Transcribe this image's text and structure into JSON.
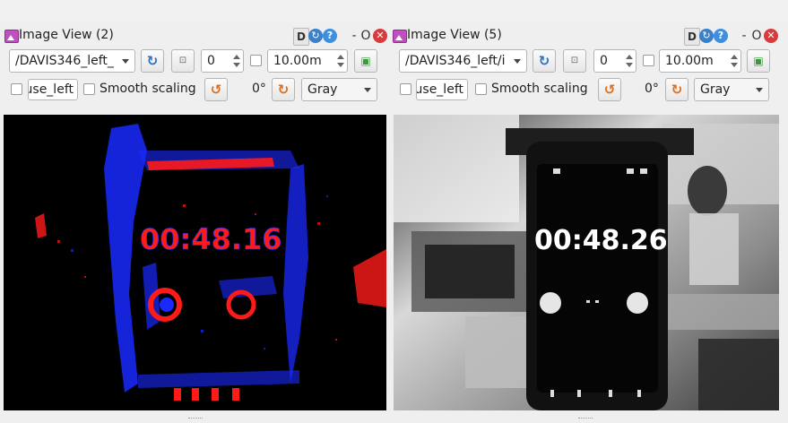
{
  "panels": [
    {
      "title": "Image View (2)",
      "titlebar_buttons": {
        "d": "D",
        "dash": "-",
        "o": "O",
        "help": "?",
        "close": "✕"
      },
      "topic": "/DAVIS346_left_",
      "spin_value": "0",
      "distance": "10.00m",
      "mouse_topic": "use_left",
      "smooth_label": "Smooth scaling",
      "rotation": "0°",
      "colormap": "Gray",
      "overlay": {
        "clock": "00:48.16"
      }
    },
    {
      "title": "Image View (5)",
      "titlebar_buttons": {
        "d": "D",
        "dash": "-",
        "o": "O",
        "help": "?",
        "close": "✕"
      },
      "topic": "/DAVIS346_left/i",
      "spin_value": "0",
      "distance": "10.00m",
      "mouse_topic": "use_left",
      "smooth_label": "Smooth scaling",
      "rotation": "0°",
      "colormap": "Gray",
      "overlay": {
        "clock": "00:48.26"
      }
    }
  ],
  "icons": {
    "refresh": "↻",
    "rotate": "↺",
    "save": "▣",
    "small": "⊡"
  },
  "colors": {
    "event_on": "#ff1a1a",
    "event_off": "#1a2aff",
    "close_red": "#d83b3b",
    "help_blue": "#3d8fe0"
  }
}
